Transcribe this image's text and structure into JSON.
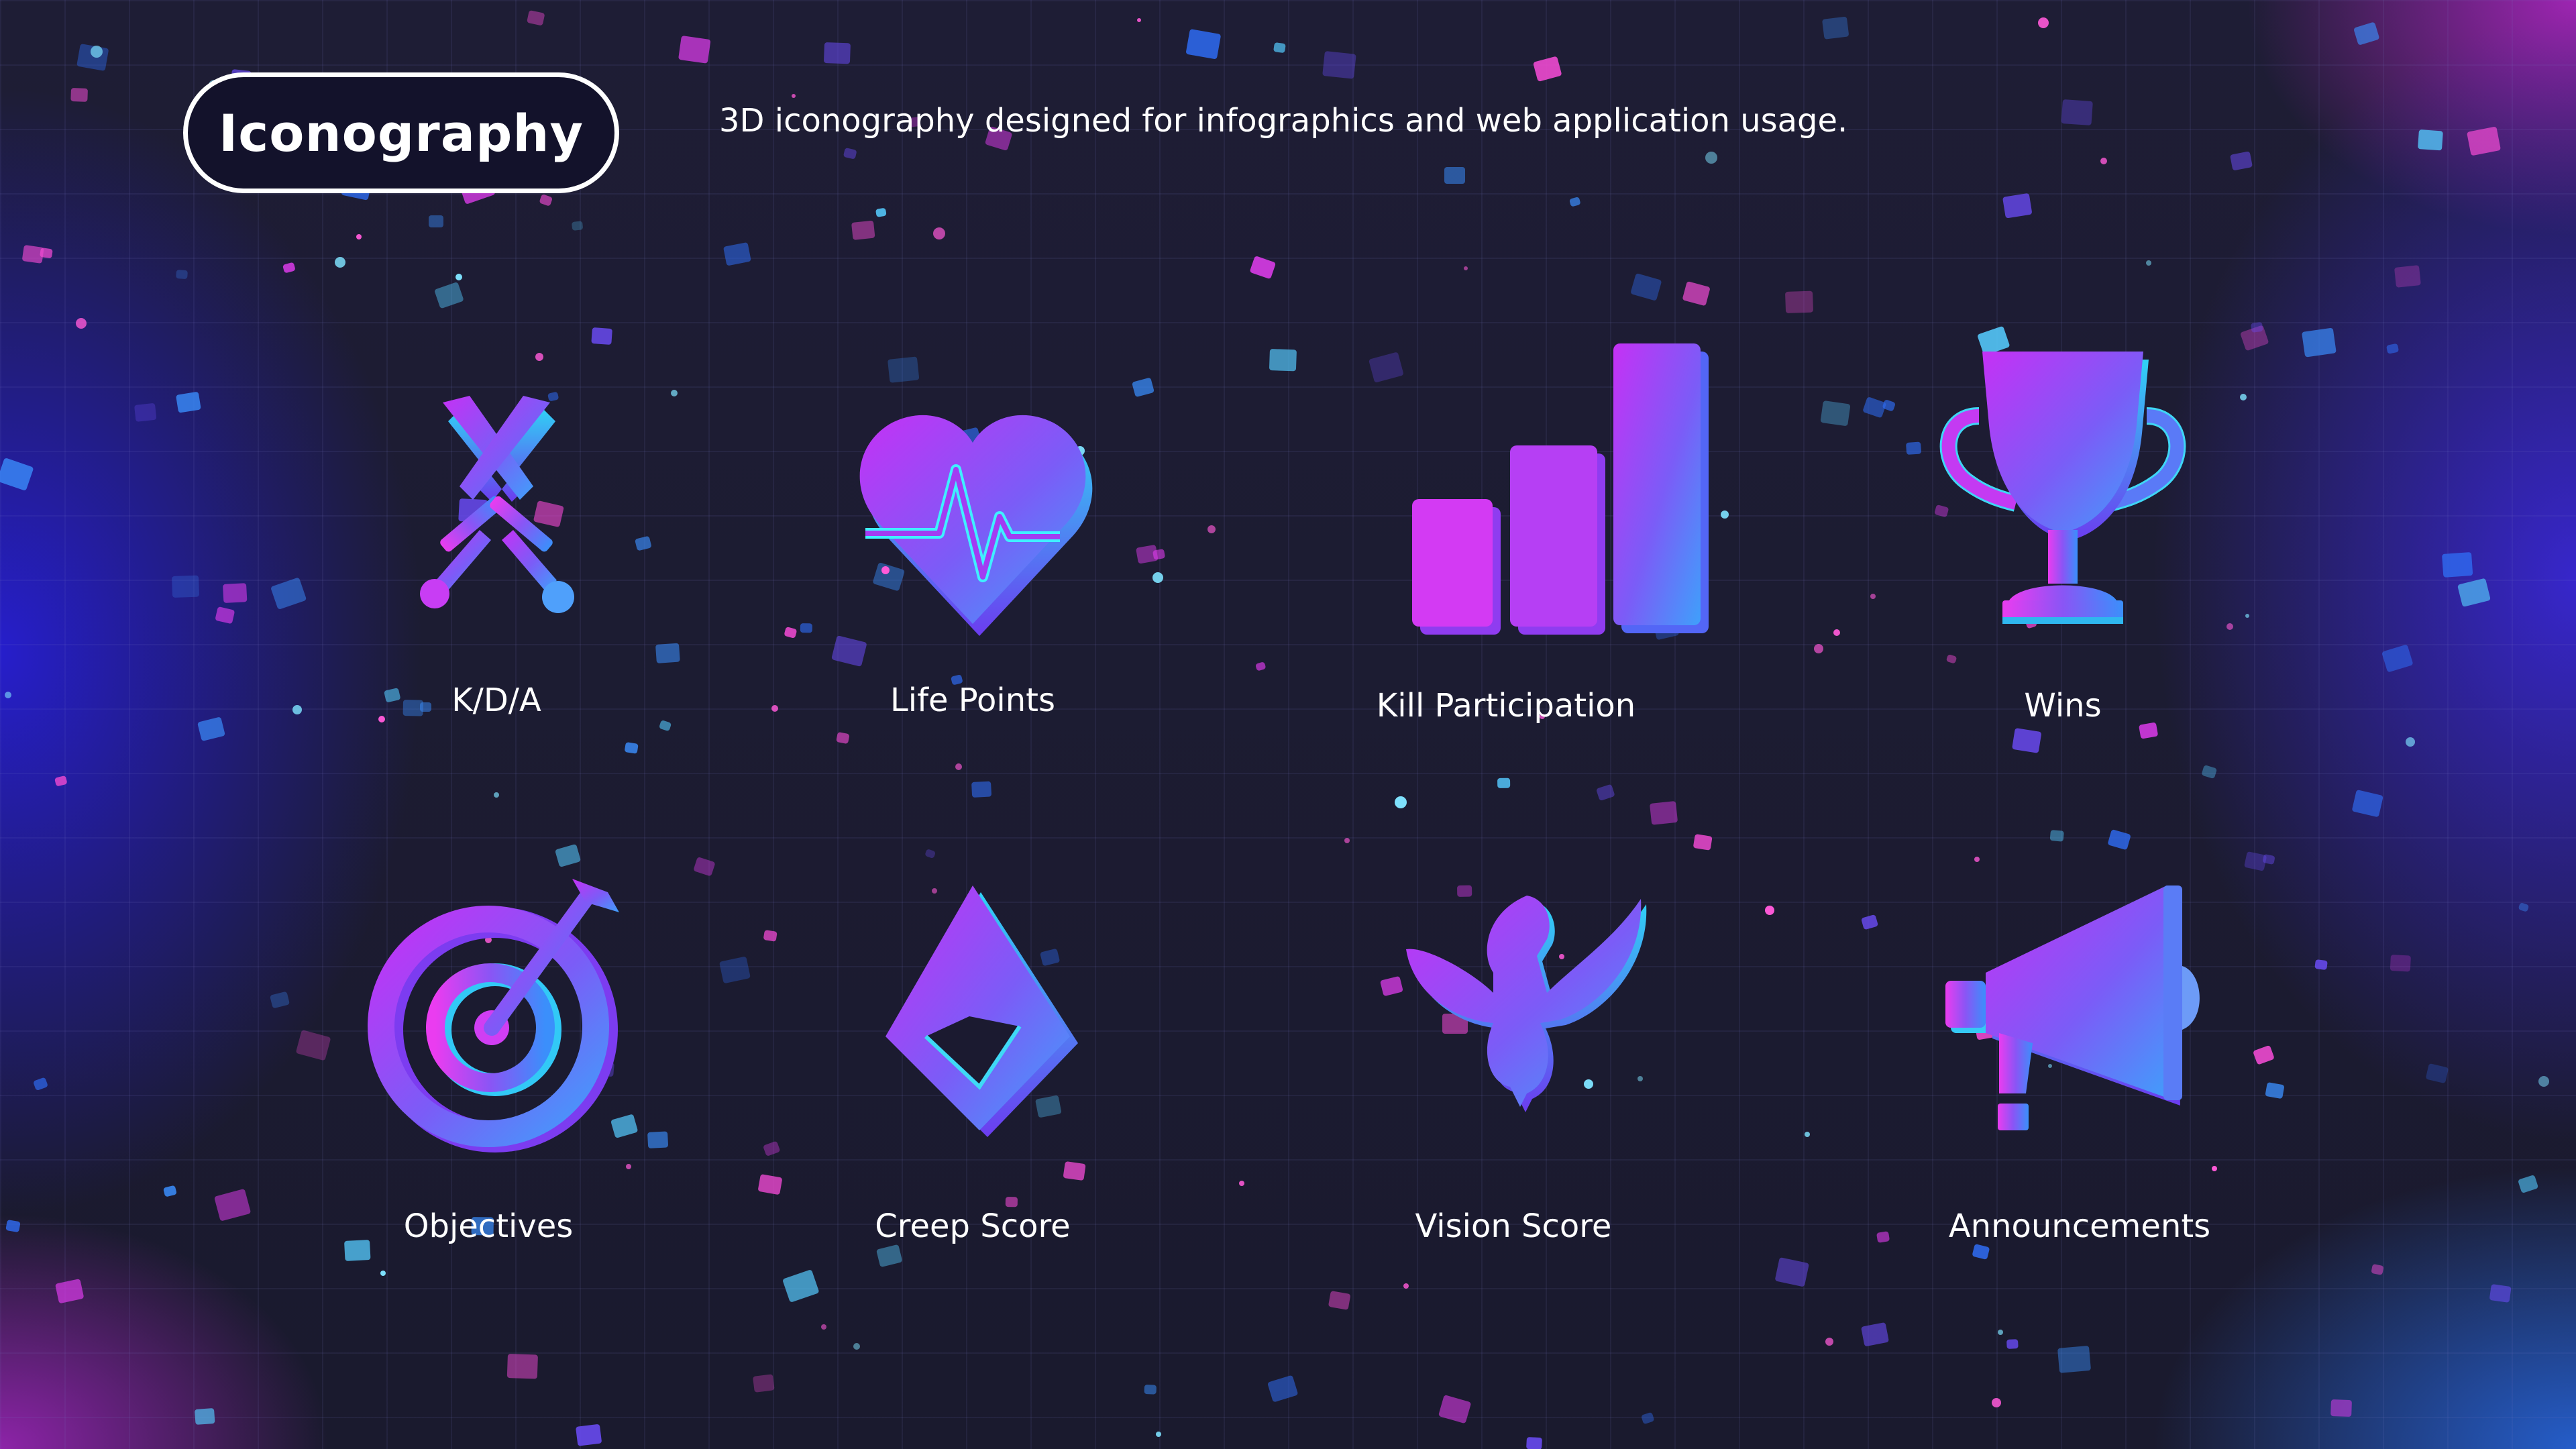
{
  "header": {
    "title": "Iconography",
    "subtitle": "3D iconography designed for infographics and web application usage."
  },
  "colors": {
    "background": "#1b1a30",
    "accent_magenta": "#d93cf2",
    "accent_blue": "#3a8dfb",
    "text": "#ffffff"
  },
  "icons": [
    {
      "icon": "crossed-swords-icon",
      "label": "K/D/A"
    },
    {
      "icon": "heart-pulse-icon",
      "label": "Life Points"
    },
    {
      "icon": "bar-chart-icon",
      "label": "Kill Participation"
    },
    {
      "icon": "trophy-icon",
      "label": "Wins"
    },
    {
      "icon": "target-icon",
      "label": "Objectives"
    },
    {
      "icon": "diamond-gem-icon",
      "label": "Creep Score"
    },
    {
      "icon": "bird-icon",
      "label": "Vision Score"
    },
    {
      "icon": "megaphone-icon",
      "label": "Announcements"
    }
  ]
}
